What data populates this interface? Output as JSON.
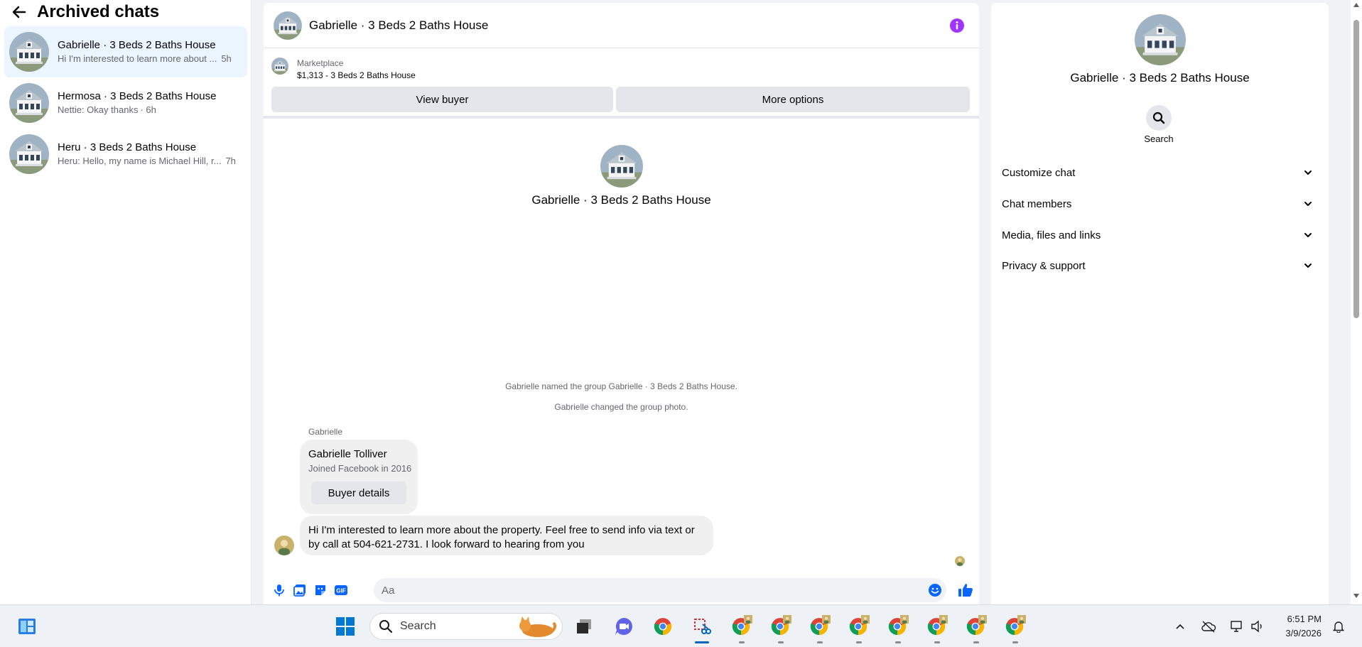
{
  "sidebar": {
    "title": "Archived chats",
    "chats": [
      {
        "name": "Gabrielle · 3 Beds 2 Baths House",
        "preview": "Hi I'm interested to learn more about ...",
        "time": "5h"
      },
      {
        "name": "Hermosa · 3 Beds 2 Baths House",
        "preview": "Nettie: Okay thanks",
        "time": "· 6h"
      },
      {
        "name": "Heru · 3 Beds 2 Baths House",
        "preview": "Heru: Hello, my name is Michael Hill, r...",
        "time": "7h"
      }
    ]
  },
  "conversation": {
    "title": "Gabrielle · 3 Beds 2 Baths House",
    "marketplace": {
      "label": "Marketplace",
      "listing": "$1,313 - 3 Beds 2 Baths House",
      "view_buyer": "View buyer",
      "more_options": "More options"
    },
    "intro_name": "Gabrielle · 3 Beds 2 Baths House",
    "system_messages": [
      "Gabrielle named the group Gabrielle · 3 Beds 2 Baths House.",
      "Gabrielle changed the group photo."
    ],
    "sender": "Gabrielle",
    "profile_card": {
      "name": "Gabrielle Tolliver",
      "subtitle": "Joined Facebook in 2016",
      "button": "Buyer details"
    },
    "message_line1": "Hi I'm interested to learn more about the property. Feel free to send info via text or",
    "message_line2": "by call at 504-621-2731. I look forward to hearing from you",
    "composer_placeholder": "Aa"
  },
  "right_panel": {
    "name": "Gabrielle · 3 Beds 2 Baths House",
    "search_label": "Search",
    "sections": [
      "Customize chat",
      "Chat members",
      "Media, files and links",
      "Privacy & support"
    ]
  },
  "taskbar": {
    "search_label": "Search",
    "time": "6:51 PM",
    "date": "3/9/2026"
  },
  "colors": {
    "accent": "#0866ff",
    "info": "#a033ff",
    "active_chat": "#ebf5ff"
  }
}
